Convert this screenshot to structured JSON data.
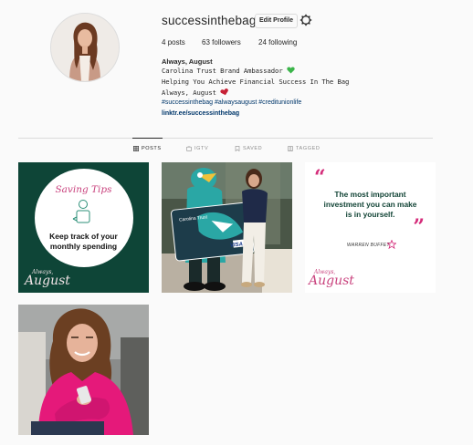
{
  "profile": {
    "username": "successinthebag",
    "edit_label": "Edit Profile",
    "posts_count": "4",
    "posts_label": "posts",
    "followers_count": "63",
    "followers_label": "followers",
    "following_count": "24",
    "following_label": "following",
    "name": "Always, August",
    "bio_lines": [
      "Carolina Trust Brand Ambassador",
      "Helping You Achieve Financial Success In The Bag",
      "Always, August"
    ],
    "hashtags": "#successinthebag #alwaysaugust #creditunionlife",
    "link": "linktr.ee/successinthebag"
  },
  "tabs": [
    {
      "label": "POSTS",
      "icon": "grid-icon",
      "active": true
    },
    {
      "label": "IGTV",
      "icon": "igtv-icon",
      "active": false
    },
    {
      "label": "SAVED",
      "icon": "bookmark-icon",
      "active": false
    },
    {
      "label": "TAGGED",
      "icon": "tag-icon",
      "active": false
    }
  ],
  "posts": {
    "p1": {
      "title": "Saving Tips",
      "text_1": "Keep track of your",
      "text_2": "monthly spending",
      "brand_1": "Always,",
      "brand_2": "August"
    },
    "p2": {
      "card_bank": "Carolina Trust",
      "card_brand": "VISA"
    },
    "p3": {
      "quote_1": "The most important",
      "quote_2": "investment you can make",
      "quote_3": "is in yourself.",
      "author": "WARREN BUFFET",
      "brand_1": "Always,",
      "brand_2": "August"
    }
  },
  "colors": {
    "accent_green": "#0e4537",
    "link_blue": "#00376b",
    "script_pink": "#c9437e",
    "quote_pink": "#d42c7a"
  }
}
